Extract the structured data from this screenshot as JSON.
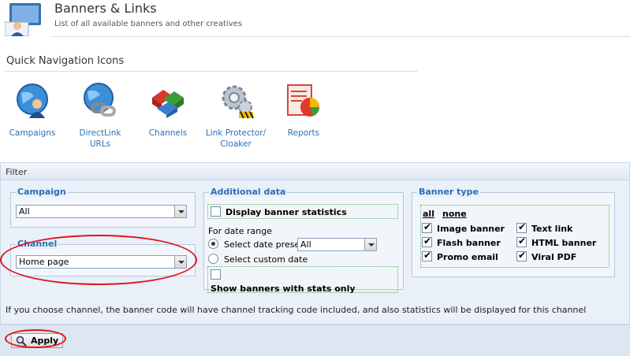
{
  "header": {
    "title": "Banners & Links",
    "subtitle": "List of all available banners and other creatives"
  },
  "quick_nav": {
    "title": "Quick Navigation Icons",
    "items": [
      {
        "label": "Campaigns",
        "icon": "campaigns-globe-user-icon"
      },
      {
        "label": "DirectLink URLs",
        "icon": "directlink-globe-chain-icon"
      },
      {
        "label": "Channels",
        "icon": "channels-blocks-icon"
      },
      {
        "label": "Link Protector/ Cloaker",
        "icon": "link-protector-gear-icon"
      },
      {
        "label": "Reports",
        "icon": "reports-chart-icon"
      }
    ]
  },
  "filter": {
    "title": "Filter",
    "campaign": {
      "legend": "Campaign",
      "value": "All"
    },
    "channel": {
      "legend": "Channel",
      "value": "Home page"
    },
    "additional": {
      "legend": "Additional data",
      "display_stats": "Display banner statistics",
      "date_range_label": "For date range",
      "preset_label": "Select date preset",
      "preset_value": "All",
      "custom_label": "Select custom date",
      "stats_only": "Show banners with stats only"
    },
    "banner_type": {
      "legend": "Banner type",
      "all": "all",
      "none": "none",
      "types": [
        {
          "label": "Image banner",
          "checked": true
        },
        {
          "label": "Text link",
          "checked": true
        },
        {
          "label": "Flash banner",
          "checked": true
        },
        {
          "label": "HTML banner",
          "checked": true
        },
        {
          "label": "Promo email",
          "checked": true
        },
        {
          "label": "Viral PDF",
          "checked": true
        }
      ]
    },
    "note": "If you choose channel, the banner code will have channel tracking code included, and also statistics will be displayed for this channel"
  },
  "footer": {
    "apply_label": "Apply"
  },
  "colors": {
    "accent": "#2a6fb7",
    "highlight": "#e0141e"
  }
}
